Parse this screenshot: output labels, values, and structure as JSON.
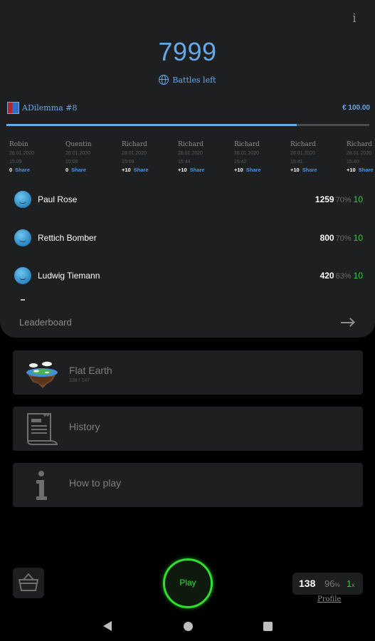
{
  "header": {
    "info_label": "i",
    "score": "7999",
    "battles_left": "Battles left"
  },
  "current_game": {
    "name": "ADilemma #8",
    "amount": "€ 100.00",
    "progress": 0.8
  },
  "history": [
    {
      "name": "Robin",
      "date": "28.01.2020",
      "time": "15:09",
      "delta": "0",
      "share": "Share"
    },
    {
      "name": "Quentin",
      "date": "28.01.2020",
      "time": "15:09",
      "delta": "0",
      "share": "Share"
    },
    {
      "name": "Richard",
      "date": "28.01.2020",
      "time": "15:09",
      "delta": "+10",
      "share": "Share"
    },
    {
      "name": "Richard",
      "date": "28.01.2020",
      "time": "15:44",
      "delta": "+10",
      "share": "Share"
    },
    {
      "name": "Richard",
      "date": "28.01.2020",
      "time": "15:42",
      "delta": "+10",
      "share": "Share"
    },
    {
      "name": "Richard",
      "date": "28.01.2020",
      "time": "15:41",
      "delta": "+10",
      "share": "Share"
    },
    {
      "name": "Richard",
      "date": "28.01.2020",
      "time": "15:40",
      "delta": "+10",
      "share": "Share"
    }
  ],
  "leaderboard": {
    "rows": [
      {
        "name": "Paul Rose",
        "points": "1259",
        "pct": "70%",
        "streak": "10"
      },
      {
        "name": "Rettich Bomber",
        "points": "800",
        "pct": "70%",
        "streak": "10"
      },
      {
        "name": "Ludwig Tiemann",
        "points": "420",
        "pct": "63%",
        "streak": "10"
      }
    ],
    "label": "Leaderboard"
  },
  "menu": {
    "flat_earth": {
      "label": "Flat Earth",
      "sub": "138 / 147"
    },
    "history": {
      "label": "History"
    },
    "how_to_play": {
      "label": "How to play"
    }
  },
  "bottom": {
    "play_label": "Play",
    "profile_points": "138",
    "profile_pct": "96",
    "profile_pct_unit": "%",
    "profile_streak": "1",
    "profile_streak_unit": "x",
    "profile_label": "Profile"
  },
  "colors": {
    "accent_blue": "#66a9e8",
    "play_green": "#2ee02e",
    "streak_green": "#3ec83e",
    "card_bg": "#1e1f21"
  }
}
